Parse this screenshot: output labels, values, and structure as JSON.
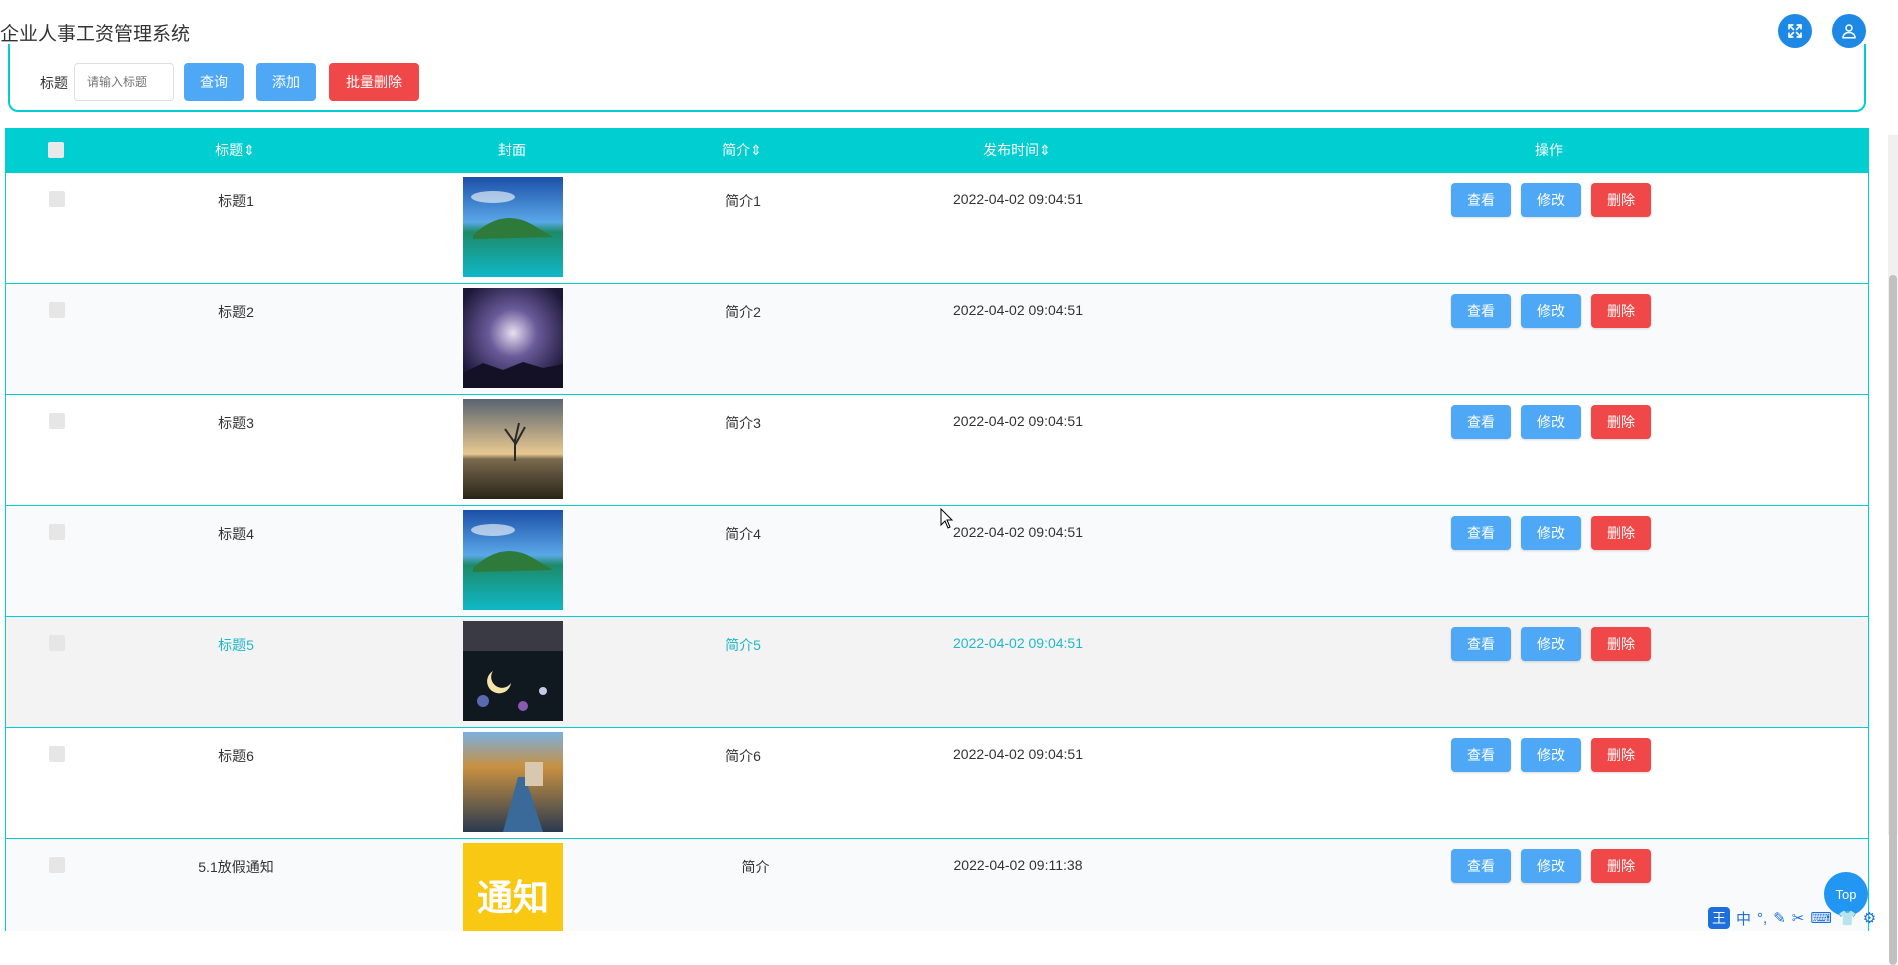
{
  "header": {
    "title": "企业人事工资管理系统",
    "fullscreen_icon": "fullscreen-icon",
    "user_icon": "user-icon"
  },
  "search": {
    "label": "标题",
    "placeholder": "请输入标题",
    "query_label": "查询",
    "add_label": "添加",
    "batch_delete_label": "批量删除"
  },
  "table": {
    "columns": [
      "标题⇕",
      "封面",
      "简介⇕",
      "发布时间⇕",
      "操作"
    ],
    "rows": [
      {
        "title": "标题1",
        "intro": "简介1",
        "time": "2022-04-02 09:04:51"
      },
      {
        "title": "标题2",
        "intro": "简介2",
        "time": "2022-04-02 09:04:51"
      },
      {
        "title": "标题3",
        "intro": "简介3",
        "time": "2022-04-02 09:04:51"
      },
      {
        "title": "标题4",
        "intro": "简介4",
        "time": "2022-04-02 09:04:51"
      },
      {
        "title": "标题5",
        "intro": "简介5",
        "time": "2022-04-02 09:04:51"
      },
      {
        "title": "标题6",
        "intro": "简介6",
        "time": "2022-04-02 09:04:51"
      },
      {
        "title": "5.1放假通知",
        "intro": "简介",
        "time": "2022-04-02 09:11:38"
      }
    ],
    "actions": {
      "view": "查看",
      "edit": "修改",
      "delete": "删除"
    },
    "notice_cover_text": "通知"
  },
  "top_button": "Top",
  "ime": {
    "logo": "王",
    "mode": "中"
  },
  "colors": {
    "accent": "#00ced1",
    "primary": "#4ea8f5",
    "danger": "#f04848"
  }
}
